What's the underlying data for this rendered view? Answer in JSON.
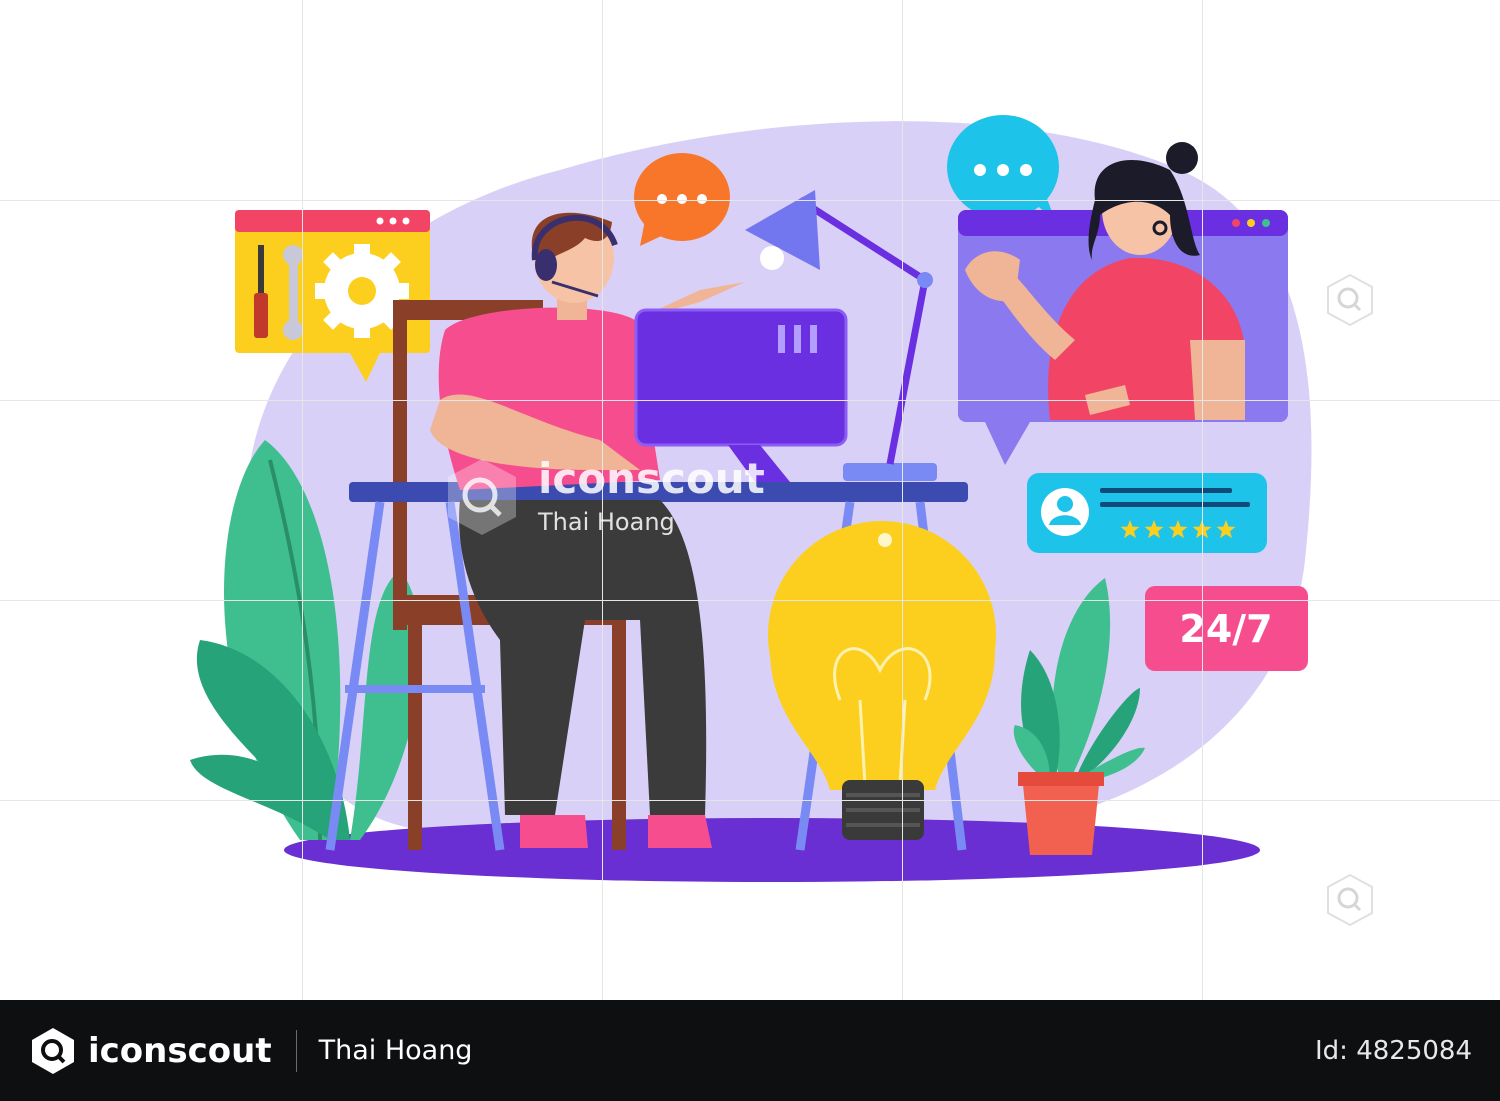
{
  "illustration": {
    "badge_text": "24/7",
    "rating_stars": 5
  },
  "watermark": {
    "brand": "iconscout",
    "author": "Thai Hoang"
  },
  "footer": {
    "brand": "iconscout",
    "author": "Thai Hoang",
    "id_label": "Id: 4825084"
  },
  "colors": {
    "background_blob": "#d9d0f7",
    "floor": "#6a2fd2",
    "monitor": "#6a2fe0",
    "lamp": "#7277f0",
    "badge": "#f64d8f",
    "rating_card": "#1ec3ea",
    "tools_window": "#fccf1f",
    "video_window": "#8b79ef",
    "footer_bg": "#0e0f11"
  }
}
